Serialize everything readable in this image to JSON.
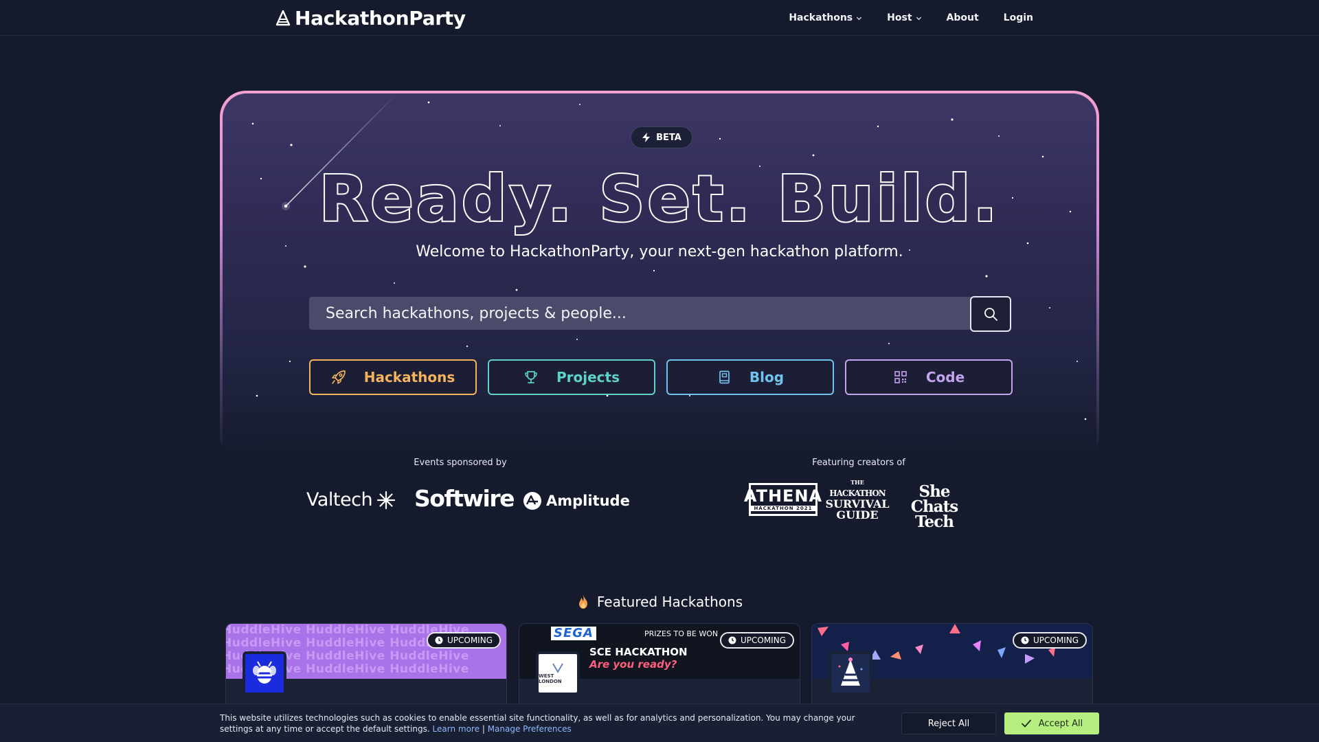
{
  "nav": {
    "brand": "HackathonParty",
    "links": [
      {
        "label": "Hackathons",
        "has_dropdown": true
      },
      {
        "label": "Host",
        "has_dropdown": true
      },
      {
        "label": "About",
        "has_dropdown": false
      },
      {
        "label": "Login",
        "has_dropdown": false
      }
    ]
  },
  "hero": {
    "badge": "BETA",
    "headline": "Ready. Set. Build.",
    "subline": "Welcome to HackathonParty, your next-gen hackathon platform.",
    "search": {
      "placeholder": "Search hackathons, projects & people...",
      "value": ""
    },
    "categories": [
      {
        "label": "Hackathons",
        "icon": "rocket-icon",
        "color": "#f5b35c"
      },
      {
        "label": "Projects",
        "icon": "trophy-icon",
        "color": "#5ed3c8"
      },
      {
        "label": "Blog",
        "icon": "book-icon",
        "color": "#6fc3ee"
      },
      {
        "label": "Code",
        "icon": "qr-code-icon",
        "color": "#c6a3ef"
      }
    ]
  },
  "sponsors": {
    "label": "Events sponsored by",
    "logos": [
      "Valtech",
      "Softwire",
      "Amplitude"
    ]
  },
  "creators": {
    "label": "Featuring creators of",
    "athena": {
      "big": "ATHENA",
      "small": "HACKATHON 2021"
    },
    "guide": {
      "line1": "THE",
      "line2": "HACKATHON",
      "line3": "SURVIVAL",
      "line4": "GUIDE"
    },
    "shechats": {
      "line1": "She Chats",
      "line2": "Tech"
    }
  },
  "featured": {
    "title": "Featured Hackathons",
    "cards": [
      {
        "badge": "UPCOMING",
        "banner_text": "HuddleHive HuddleHive HuddleHive"
      },
      {
        "badge": "UPCOMING",
        "sega": "SEGA",
        "prizes": "PRIZES TO BE WON",
        "title1": "SCE HACKATHON",
        "title2": "Are you ready?",
        "avatar_text": "WEST LONDON"
      },
      {
        "badge": "UPCOMING"
      }
    ]
  },
  "cookie": {
    "text": "This website utilizes technologies such as cookies to enable essential site functionality, as well as for analytics and personalization. You may change your settings at any time or accept the default settings.",
    "learn_more": "Learn more",
    "separator": "|",
    "manage": "Manage Preferences",
    "reject": "Reject All",
    "accept": "Accept All"
  },
  "colors": {
    "background": "#151b2c",
    "hero_border": "#f4a0d2",
    "accept": "#b6ee7f",
    "hackathons": "#f5b35c",
    "projects": "#5ed3c8",
    "blog": "#6fc3ee",
    "code": "#c6a3ef"
  }
}
